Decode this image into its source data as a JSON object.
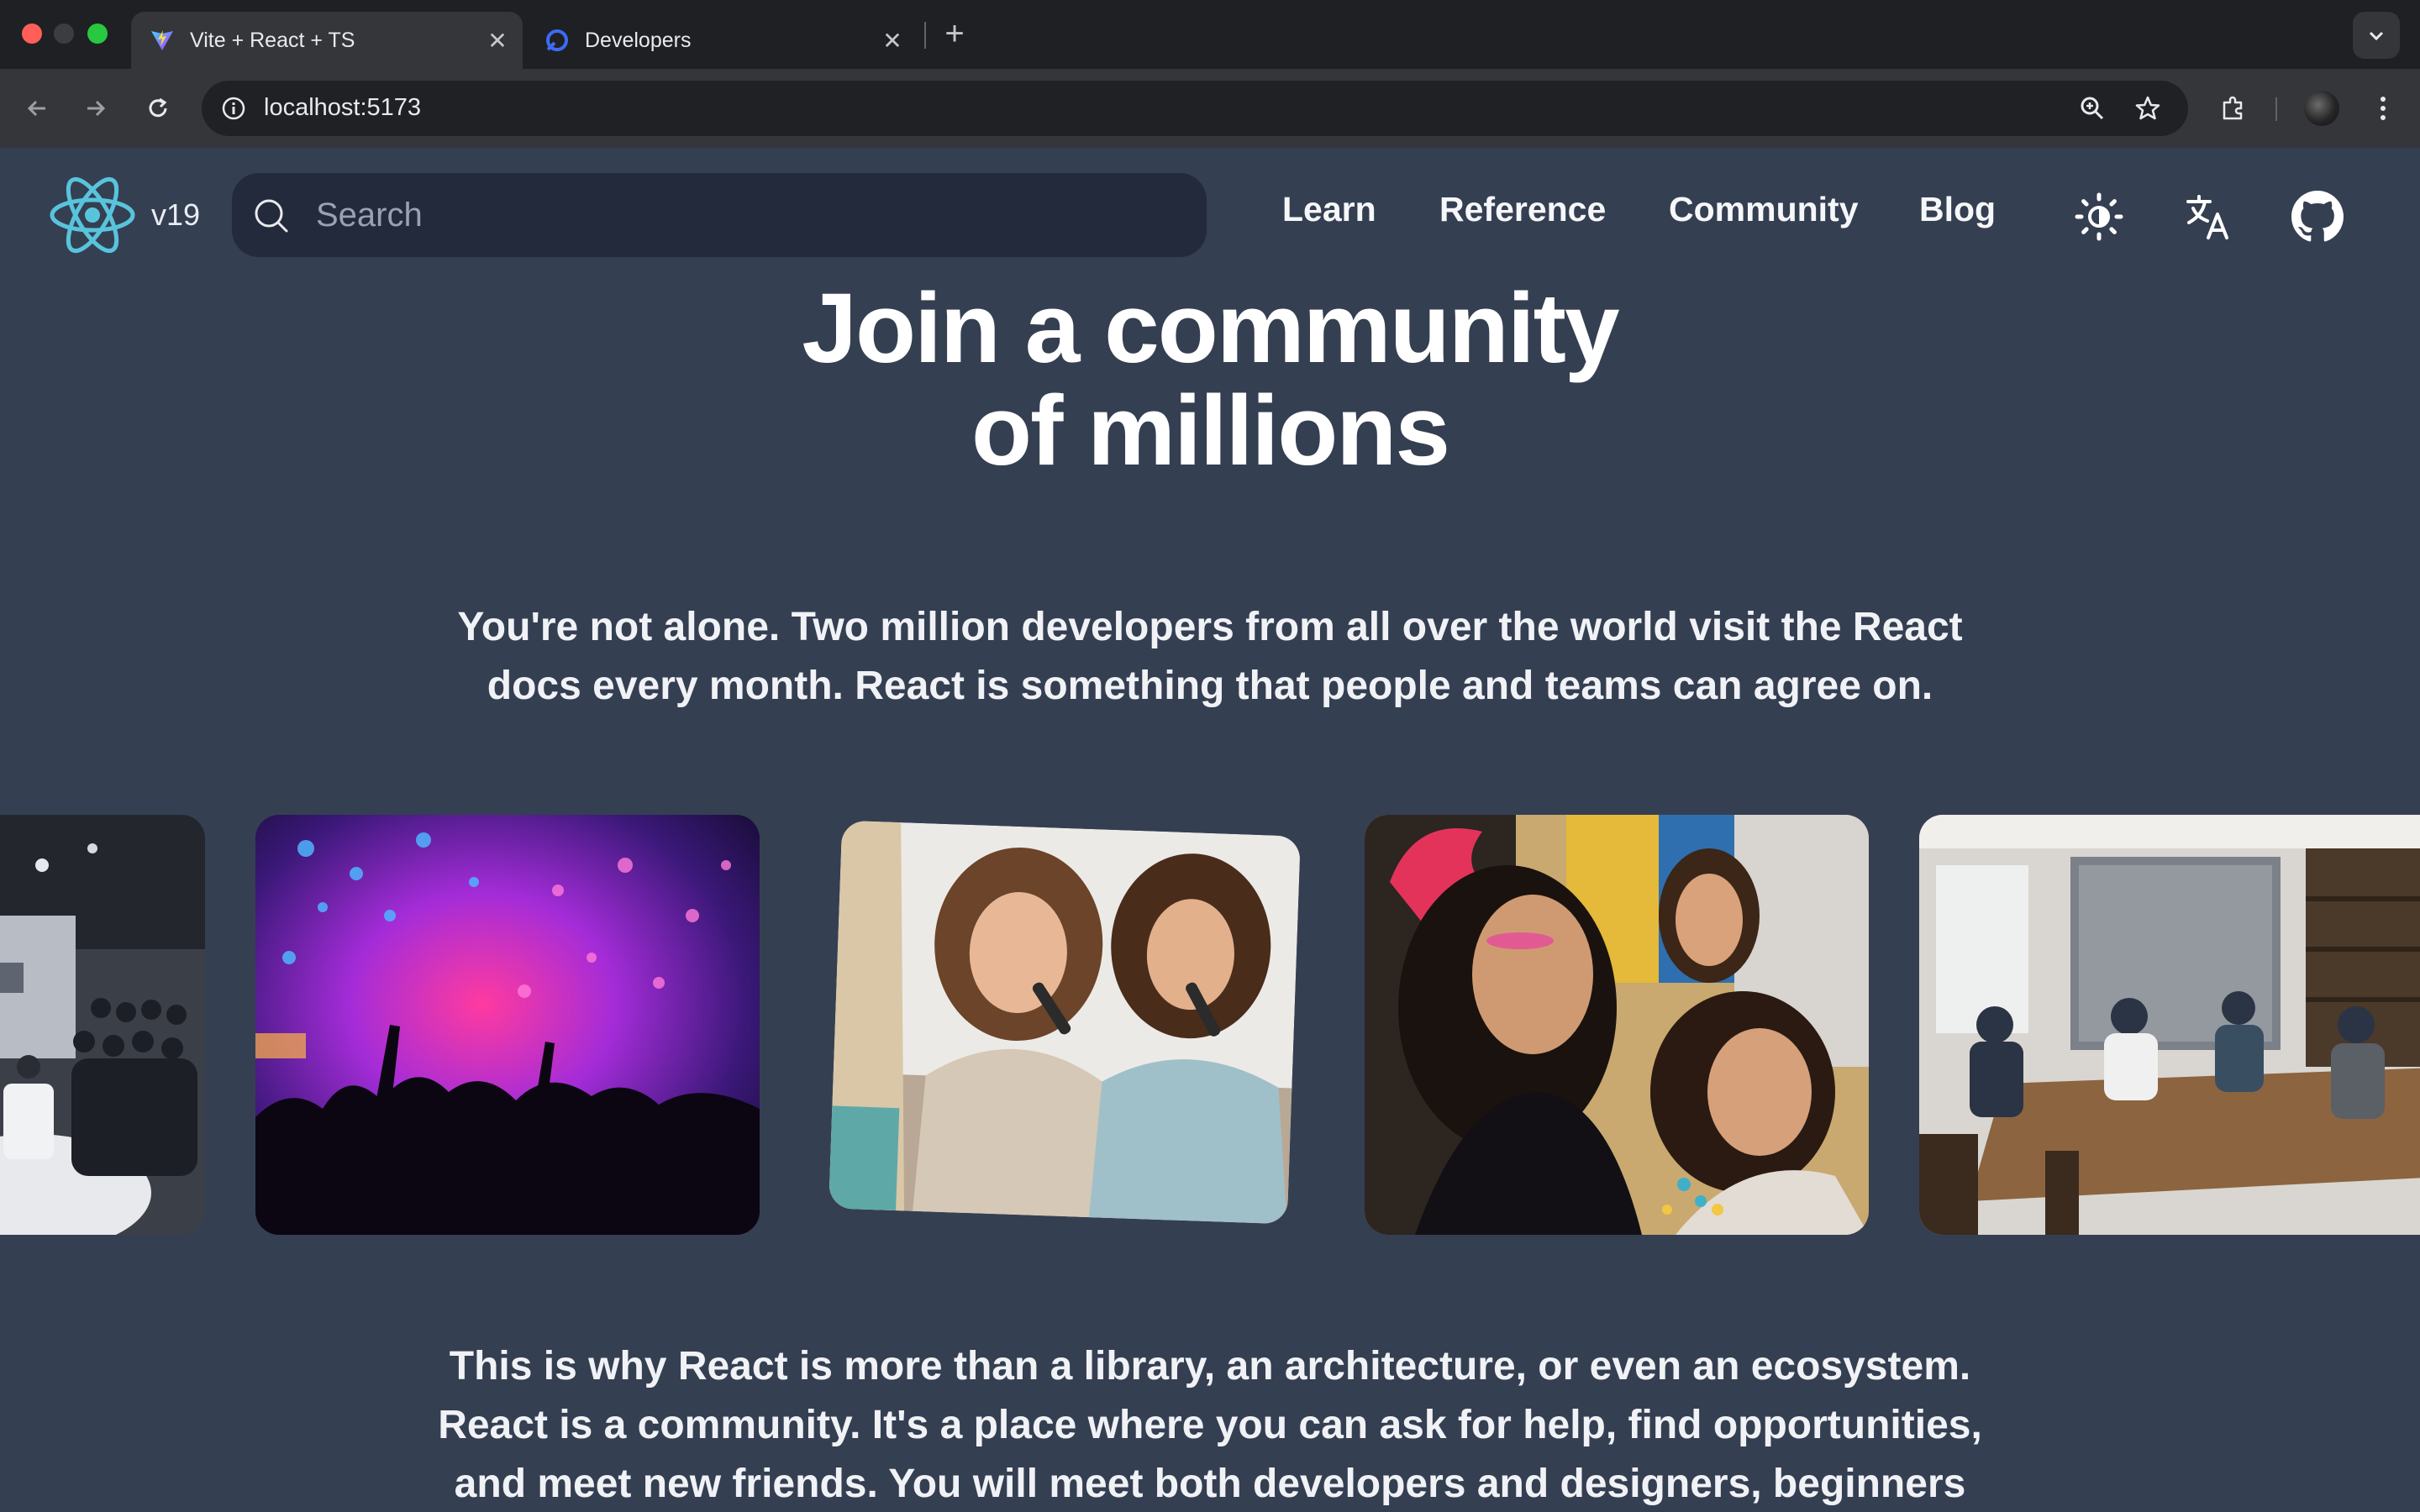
{
  "browser": {
    "tabs": [
      {
        "title": "Vite + React + TS",
        "active": true,
        "favicon": "vite-icon"
      },
      {
        "title": "Developers",
        "active": false,
        "favicon": "developers-icon"
      }
    ],
    "url": "localhost:5173"
  },
  "header": {
    "version": "v19",
    "search_placeholder": "Search",
    "nav": [
      "Learn",
      "Reference",
      "Community",
      "Blog"
    ],
    "icons": [
      "theme-toggle-icon",
      "language-icon",
      "github-icon"
    ]
  },
  "hero": {
    "title_line1": "Join a community",
    "title_line2": "of millions",
    "subtitle": "You're not alone. Two million developers from all over the world visit the React docs every month. React is something that people and teams can agree on."
  },
  "photos": [
    "conference-audience",
    "concert-crowd",
    "friends-singing-karaoke",
    "carnival-celebration",
    "team-meeting-table"
  ],
  "body": {
    "paragraph": "This is why React is more than a library, an architecture, or even an ecosystem. React is a community. It's a place where you can ask for help, find opportunities, and meet new friends. You will meet both developers and designers, beginners"
  },
  "colors": {
    "page_bg": "#353f52",
    "react_blue": "#58c4dc",
    "search_bg": "#232a3c"
  }
}
